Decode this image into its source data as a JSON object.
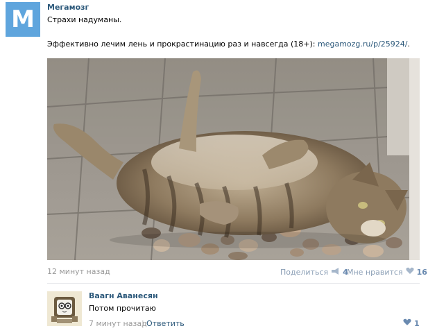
{
  "post": {
    "avatar_letter": "M",
    "author": "Мегамозг",
    "text_line1": "Страхи надуманы.",
    "text_line2": "Эффективно лечим лень и прокрастинацию раз и навсегда (18+): ",
    "link": "megamozg.ru/p/25924/",
    "link_suffix": ".",
    "time": "12 минут назад",
    "share_label": "Поделиться",
    "share_count": "4",
    "like_label": "Мне нравится",
    "like_count": "16",
    "brand_color": "#5fa5dd",
    "link_color": "#2b587a"
  },
  "comment": {
    "author": "Ваагн Аванесян",
    "text": "Потом прочитаю",
    "time": "7 минут назад",
    "separator": "|",
    "reply_label": "Ответить",
    "like_count": "1"
  },
  "icons": {
    "share": "megaphone-icon",
    "like": "heart-icon",
    "comment_like": "heart-icon"
  }
}
